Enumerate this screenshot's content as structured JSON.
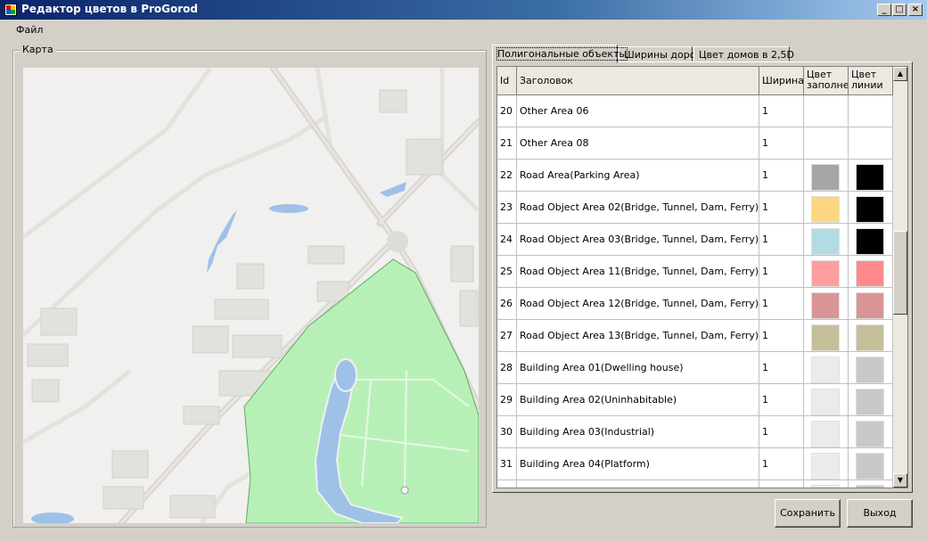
{
  "window": {
    "title": "Редактор цветов в ProGorod"
  },
  "menu": {
    "file": "Файл"
  },
  "group": {
    "map_label": "Карта"
  },
  "tabs": [
    {
      "label": "Полигональные объекты"
    },
    {
      "label": "Ширины дорог"
    },
    {
      "label": "Цвет домов в 2,5D"
    }
  ],
  "grid": {
    "headers": {
      "id": "Id",
      "title": "Заголовок",
      "width": "Ширина",
      "fill": "Цвет заполне",
      "line": "Цвет линии"
    },
    "rows": [
      {
        "id": "20",
        "title": "Other Area 06",
        "width": "1",
        "fill": null,
        "line": null
      },
      {
        "id": "21",
        "title": "Other Area 08",
        "width": "1",
        "fill": null,
        "line": null
      },
      {
        "id": "22",
        "title": "Road Area(Parking Area)",
        "width": "1",
        "fill": "#a6a6a6",
        "line": "#000000"
      },
      {
        "id": "23",
        "title": "Road Object Area 02(Bridge, Tunnel, Dam, Ferry)",
        "width": "1",
        "fill": "#fcd77f",
        "line": "#000000"
      },
      {
        "id": "24",
        "title": "Road Object Area 03(Bridge, Tunnel, Dam, Ferry)",
        "width": "1",
        "fill": "#b3dbe2",
        "line": "#000000"
      },
      {
        "id": "25",
        "title": "Road Object Area 11(Bridge, Tunnel, Dam, Ferry)",
        "width": "1",
        "fill": "#ff9e9e",
        "line": "#ff8a8a"
      },
      {
        "id": "26",
        "title": "Road Object Area 12(Bridge, Tunnel, Dam, Ferry)",
        "width": "1",
        "fill": "#d99595",
        "line": "#d99595"
      },
      {
        "id": "27",
        "title": "Road Object Area 13(Bridge, Tunnel, Dam, Ferry)",
        "width": "1",
        "fill": "#c4bf99",
        "line": "#c4bf99"
      },
      {
        "id": "28",
        "title": "Building Area 01(Dwelling house)",
        "width": "1",
        "fill": "#ebebeb",
        "line": "#c8c8c8"
      },
      {
        "id": "29",
        "title": "Building Area 02(Uninhabitable)",
        "width": "1",
        "fill": "#ebebeb",
        "line": "#c8c8c8"
      },
      {
        "id": "30",
        "title": "Building Area 03(Industrial)",
        "width": "1",
        "fill": "#ebebeb",
        "line": "#c8c8c8"
      },
      {
        "id": "31",
        "title": "Building Area 04(Platform)",
        "width": "1",
        "fill": "#ebebeb",
        "line": "#c8c8c8"
      },
      {
        "id": "",
        "title": "",
        "width": "",
        "fill": "#ebebeb",
        "line": "#c8c8c8"
      }
    ]
  },
  "buttons": {
    "save": "Сохранить",
    "exit": "Выход"
  },
  "colors": {
    "park": "#b7f0b7",
    "water": "#9ec1e8",
    "road": "#dddad4",
    "map_bg": "#f1f0ee",
    "building": "#e3e1de"
  }
}
